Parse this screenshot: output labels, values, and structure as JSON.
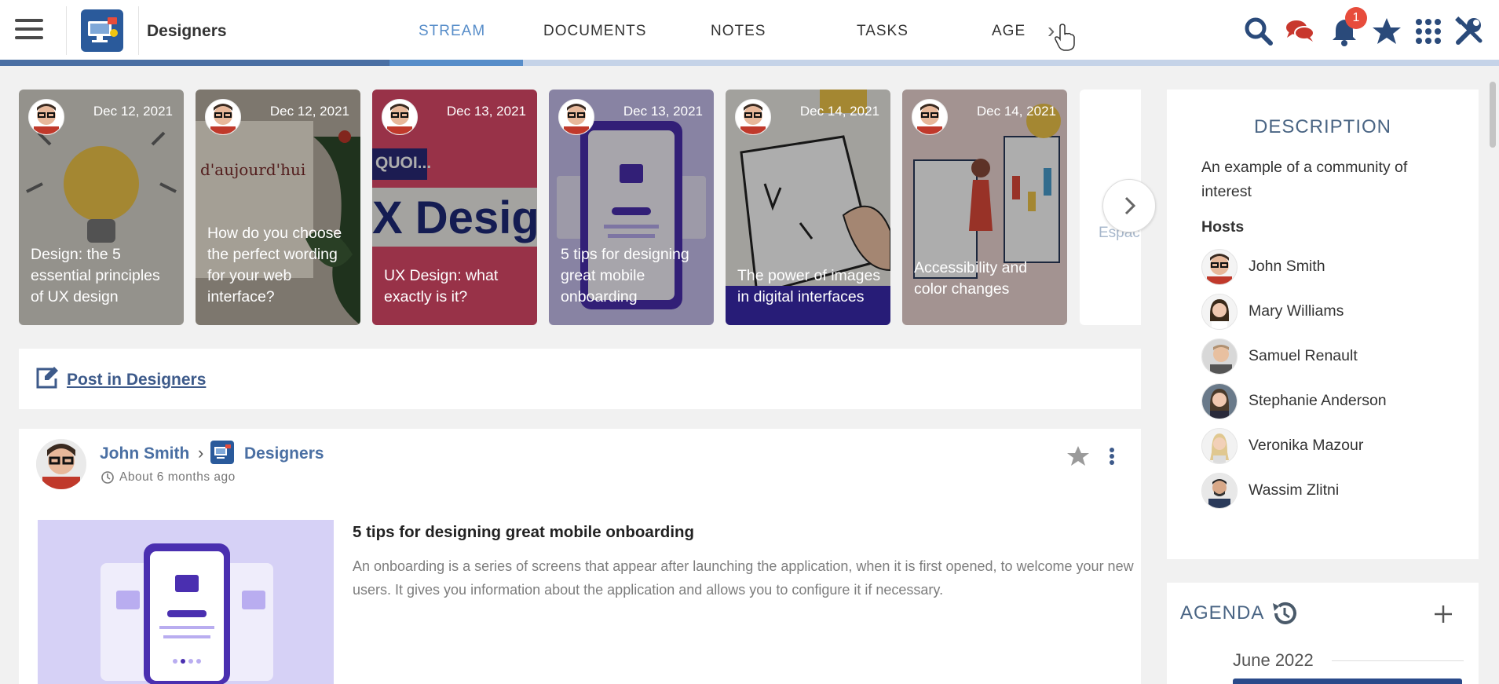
{
  "header": {
    "space_name": "Designers",
    "tabs": [
      {
        "label": "STREAM",
        "active": true
      },
      {
        "label": "DOCUMENTS",
        "active": false
      },
      {
        "label": "NOTES",
        "active": false
      },
      {
        "label": "TASKS",
        "active": false
      },
      {
        "label": "AGE",
        "active": false
      }
    ],
    "notification_count": "1",
    "icons": [
      "menu-icon",
      "search-icon",
      "chat-icon",
      "bell-icon",
      "star-icon",
      "apps-grid-icon",
      "admin-tools-icon"
    ],
    "accent_color": "#578dc9"
  },
  "carousel": {
    "items": [
      {
        "date": "Dec 12, 2021",
        "title": "Design: the 5 essential principles of UX design"
      },
      {
        "date": "Dec 12, 2021",
        "title": "How do you choose the perfect wording for your web interface?"
      },
      {
        "date": "Dec 13, 2021",
        "title": "UX Design: what exactly is it?"
      },
      {
        "date": "Dec 13, 2021",
        "title": "5 tips for designing great mobile onboarding"
      },
      {
        "date": "Dec 14, 2021",
        "title": "The power of images in digital interfaces"
      },
      {
        "date": "Dec 14, 2021",
        "title": "Accessibility and color changes"
      }
    ],
    "partial_label": "Espac",
    "card2_image_text": "d'aujourd'hui",
    "card3_image_text_1": "QUOI...",
    "card3_image_text_2": "X Desig"
  },
  "composer": {
    "label": "Post in Designers"
  },
  "activity": {
    "author": "John Smith",
    "space": "Designers",
    "time": "About 6 months ago",
    "title": "5 tips for designing great mobile onboarding",
    "excerpt": "An onboarding is a series of screens that appear after launching the application, when it is first opened, to welcome your new users. It gives you information about the application and allows you to configure it if necessary."
  },
  "description": {
    "title": "DESCRIPTION",
    "text": "An example of a community of interest",
    "hosts_label": "Hosts",
    "hosts": [
      "John Smith",
      "Mary Williams",
      "Samuel Renault",
      "Stephanie Anderson",
      "Veronika Mazour",
      "Wassim Zlitni"
    ]
  },
  "agenda": {
    "title": "AGENDA",
    "month": "June 2022"
  }
}
